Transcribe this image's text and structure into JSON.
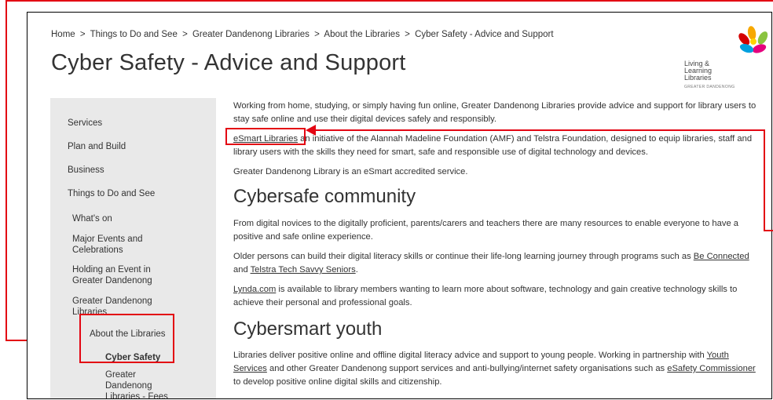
{
  "breadcrumb": {
    "items": [
      "Home",
      ">",
      "Things to Do and See",
      ">",
      "Greater Dandenong Libraries",
      ">",
      "About the Libraries",
      ">",
      "Cyber Safety - Advice and Support"
    ]
  },
  "page": {
    "title": "Cyber Safety - Advice and Support"
  },
  "logo": {
    "line1": "Living &",
    "line2": "Learning",
    "line3": "Libraries",
    "sub": "GREATER DANDENONG"
  },
  "sidebar": {
    "items": [
      {
        "label": "Services"
      },
      {
        "label": "Plan and Build"
      },
      {
        "label": "Business"
      },
      {
        "label": "Things to Do and See"
      },
      {
        "label": "What's on"
      },
      {
        "label": "Major Events and Celebrations"
      },
      {
        "label": "Holding an Event in Greater Dandenong"
      },
      {
        "label": "Greater Dandenong Libraries"
      },
      {
        "label": "About the Libraries"
      },
      {
        "label": "Cyber Safety"
      },
      {
        "label": "Greater Dandenong Libraries - Fees"
      }
    ]
  },
  "content": {
    "intro": "Working from home, studying, or simply having fun online, Greater Dandenong Libraries provide advice and support for library users to stay safe online and use their digital devices safely and responsibly.",
    "esmart_link": "eSmart Libraries",
    "esmart_text": " an initiative of the Alannah Madeline Foundation (AMF) and Telstra Foundation, designed to equip libraries, staff and library users with the skills they need for smart, safe and responsible use of digital technology and devices.",
    "accredited": "Greater Dandenong Library is an eSmart accredited service.",
    "h_community": "Cybersafe community",
    "community_p1": "From digital novices to the digitally proficient, parents/carers and teachers there are many resources to enable everyone to have a positive and safe online experience.",
    "community_p2_a": "Older persons can build their digital literacy skills or continue their life-long learning journey through programs such as ",
    "be_connected": "Be Connected",
    "community_p2_b": " and ",
    "tech_savvy": "Telstra Tech Savvy Seniors",
    "community_p2_c": ".",
    "lynda_link": "Lynda.com",
    "lynda_text": " is available to library members wanting to learn more about software, technology and gain creative technology skills to achieve their personal and professional goals.",
    "h_youth": "Cybersmart youth",
    "youth_a": "Libraries deliver positive online and offline digital literacy advice and support to young people. Working in partnership with ",
    "youth_services": "Youth Services",
    "youth_b": " and other Greater Dandenong support services and anti-bullying/internet safety organisations such as ",
    "esafety": "eSafety Commissioner",
    "youth_c": " to develop positive online digital skills and citizenship."
  },
  "colors": {
    "annotation": "#e30613",
    "sidebar_bg": "#e9e9e9",
    "text": "#333333"
  }
}
